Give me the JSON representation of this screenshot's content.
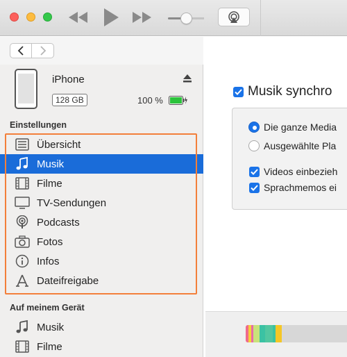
{
  "toolbar": {
    "icons": [
      "close-button",
      "minimize-button",
      "zoom-button",
      "rewind-icon",
      "play-icon",
      "fast-forward-icon",
      "volume-slider",
      "airplay-icon"
    ],
    "volume_level": 0.45
  },
  "nav": {
    "back": "back-arrow",
    "forward": "forward-arrow"
  },
  "device": {
    "name": "iPhone",
    "capacity": "128 GB",
    "battery": "100 %",
    "battery_color": "#2bc33b"
  },
  "sidebar": {
    "settings_heading": "Einstellungen",
    "settings_items": [
      {
        "label": "Übersicht",
        "icon": "summary-list-icon"
      },
      {
        "label": "Musik",
        "icon": "music-note-icon",
        "selected": true
      },
      {
        "label": "Filme",
        "icon": "film-strip-icon"
      },
      {
        "label": "TV-Sendungen",
        "icon": "tv-icon"
      },
      {
        "label": "Podcasts",
        "icon": "podcast-icon"
      },
      {
        "label": "Fotos",
        "icon": "camera-icon"
      },
      {
        "label": "Infos",
        "icon": "info-icon"
      },
      {
        "label": "Dateifreigabe",
        "icon": "file-sharing-icon"
      }
    ],
    "device_heading": "Auf meinem Gerät",
    "device_items": [
      {
        "label": "Musik",
        "icon": "music-note-icon"
      },
      {
        "label": "Filme",
        "icon": "film-strip-icon"
      }
    ],
    "selection_color": "#1a6cd9",
    "highlight_color": "#f37f3a"
  },
  "main": {
    "sync_label": "Musik synchro",
    "radio_all": "Die ganze Media",
    "radio_selected": "Ausgewählte Pla",
    "check_videos": "Videos einbezieh",
    "check_memos": "Sprachmemos ei"
  },
  "storage_colors": [
    "#ef6a8c",
    "#f5cf3a",
    "#c9e27a",
    "#3bc2a3",
    "#52c7a0",
    "#f5c726",
    "#d7d7d7"
  ]
}
